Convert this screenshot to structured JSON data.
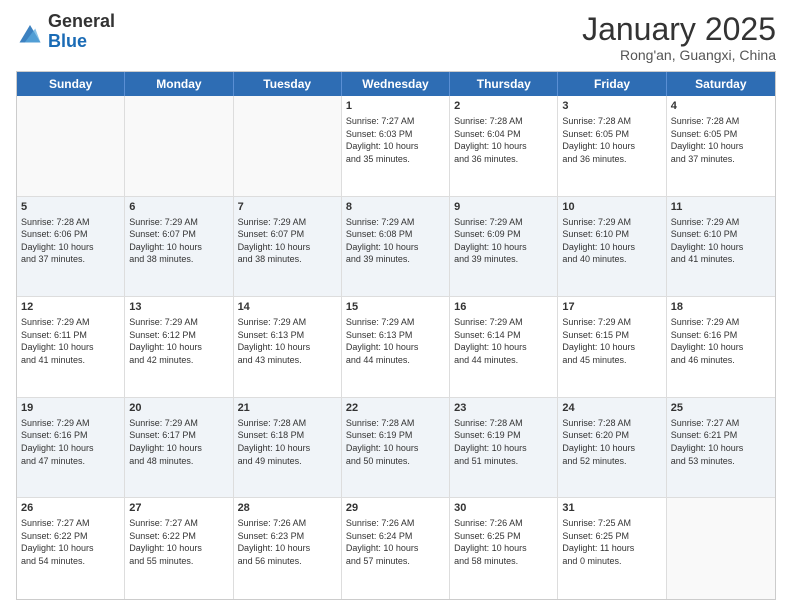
{
  "logo": {
    "general": "General",
    "blue": "Blue"
  },
  "header": {
    "month": "January 2025",
    "location": "Rong'an, Guangxi, China"
  },
  "weekdays": [
    "Sunday",
    "Monday",
    "Tuesday",
    "Wednesday",
    "Thursday",
    "Friday",
    "Saturday"
  ],
  "weeks": [
    [
      {
        "day": "",
        "text": "",
        "empty": true
      },
      {
        "day": "",
        "text": "",
        "empty": true
      },
      {
        "day": "",
        "text": "",
        "empty": true
      },
      {
        "day": "1",
        "text": "Sunrise: 7:27 AM\nSunset: 6:03 PM\nDaylight: 10 hours\nand 35 minutes."
      },
      {
        "day": "2",
        "text": "Sunrise: 7:28 AM\nSunset: 6:04 PM\nDaylight: 10 hours\nand 36 minutes."
      },
      {
        "day": "3",
        "text": "Sunrise: 7:28 AM\nSunset: 6:05 PM\nDaylight: 10 hours\nand 36 minutes."
      },
      {
        "day": "4",
        "text": "Sunrise: 7:28 AM\nSunset: 6:05 PM\nDaylight: 10 hours\nand 37 minutes."
      }
    ],
    [
      {
        "day": "5",
        "text": "Sunrise: 7:28 AM\nSunset: 6:06 PM\nDaylight: 10 hours\nand 37 minutes.",
        "shaded": true
      },
      {
        "day": "6",
        "text": "Sunrise: 7:29 AM\nSunset: 6:07 PM\nDaylight: 10 hours\nand 38 minutes.",
        "shaded": true
      },
      {
        "day": "7",
        "text": "Sunrise: 7:29 AM\nSunset: 6:07 PM\nDaylight: 10 hours\nand 38 minutes.",
        "shaded": true
      },
      {
        "day": "8",
        "text": "Sunrise: 7:29 AM\nSunset: 6:08 PM\nDaylight: 10 hours\nand 39 minutes.",
        "shaded": true
      },
      {
        "day": "9",
        "text": "Sunrise: 7:29 AM\nSunset: 6:09 PM\nDaylight: 10 hours\nand 39 minutes.",
        "shaded": true
      },
      {
        "day": "10",
        "text": "Sunrise: 7:29 AM\nSunset: 6:10 PM\nDaylight: 10 hours\nand 40 minutes.",
        "shaded": true
      },
      {
        "day": "11",
        "text": "Sunrise: 7:29 AM\nSunset: 6:10 PM\nDaylight: 10 hours\nand 41 minutes.",
        "shaded": true
      }
    ],
    [
      {
        "day": "12",
        "text": "Sunrise: 7:29 AM\nSunset: 6:11 PM\nDaylight: 10 hours\nand 41 minutes."
      },
      {
        "day": "13",
        "text": "Sunrise: 7:29 AM\nSunset: 6:12 PM\nDaylight: 10 hours\nand 42 minutes."
      },
      {
        "day": "14",
        "text": "Sunrise: 7:29 AM\nSunset: 6:13 PM\nDaylight: 10 hours\nand 43 minutes."
      },
      {
        "day": "15",
        "text": "Sunrise: 7:29 AM\nSunset: 6:13 PM\nDaylight: 10 hours\nand 44 minutes."
      },
      {
        "day": "16",
        "text": "Sunrise: 7:29 AM\nSunset: 6:14 PM\nDaylight: 10 hours\nand 44 minutes."
      },
      {
        "day": "17",
        "text": "Sunrise: 7:29 AM\nSunset: 6:15 PM\nDaylight: 10 hours\nand 45 minutes."
      },
      {
        "day": "18",
        "text": "Sunrise: 7:29 AM\nSunset: 6:16 PM\nDaylight: 10 hours\nand 46 minutes."
      }
    ],
    [
      {
        "day": "19",
        "text": "Sunrise: 7:29 AM\nSunset: 6:16 PM\nDaylight: 10 hours\nand 47 minutes.",
        "shaded": true
      },
      {
        "day": "20",
        "text": "Sunrise: 7:29 AM\nSunset: 6:17 PM\nDaylight: 10 hours\nand 48 minutes.",
        "shaded": true
      },
      {
        "day": "21",
        "text": "Sunrise: 7:28 AM\nSunset: 6:18 PM\nDaylight: 10 hours\nand 49 minutes.",
        "shaded": true
      },
      {
        "day": "22",
        "text": "Sunrise: 7:28 AM\nSunset: 6:19 PM\nDaylight: 10 hours\nand 50 minutes.",
        "shaded": true
      },
      {
        "day": "23",
        "text": "Sunrise: 7:28 AM\nSunset: 6:19 PM\nDaylight: 10 hours\nand 51 minutes.",
        "shaded": true
      },
      {
        "day": "24",
        "text": "Sunrise: 7:28 AM\nSunset: 6:20 PM\nDaylight: 10 hours\nand 52 minutes.",
        "shaded": true
      },
      {
        "day": "25",
        "text": "Sunrise: 7:27 AM\nSunset: 6:21 PM\nDaylight: 10 hours\nand 53 minutes.",
        "shaded": true
      }
    ],
    [
      {
        "day": "26",
        "text": "Sunrise: 7:27 AM\nSunset: 6:22 PM\nDaylight: 10 hours\nand 54 minutes."
      },
      {
        "day": "27",
        "text": "Sunrise: 7:27 AM\nSunset: 6:22 PM\nDaylight: 10 hours\nand 55 minutes."
      },
      {
        "day": "28",
        "text": "Sunrise: 7:26 AM\nSunset: 6:23 PM\nDaylight: 10 hours\nand 56 minutes."
      },
      {
        "day": "29",
        "text": "Sunrise: 7:26 AM\nSunset: 6:24 PM\nDaylight: 10 hours\nand 57 minutes."
      },
      {
        "day": "30",
        "text": "Sunrise: 7:26 AM\nSunset: 6:25 PM\nDaylight: 10 hours\nand 58 minutes."
      },
      {
        "day": "31",
        "text": "Sunrise: 7:25 AM\nSunset: 6:25 PM\nDaylight: 11 hours\nand 0 minutes."
      },
      {
        "day": "",
        "text": "",
        "empty": true
      }
    ]
  ]
}
